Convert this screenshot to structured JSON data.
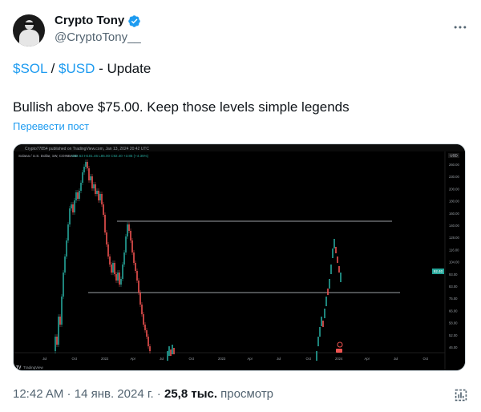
{
  "author": {
    "display_name": "Crypto Tony",
    "handle": "@CryptoTony__",
    "verified_color": "#1d9bf0"
  },
  "tweet": {
    "pair_base": "$SOL",
    "separator": " / ",
    "pair_quote": "$USD",
    "title_suffix": " - Update",
    "body": "Bullish above $75.00. Keep those levels simple legends",
    "translate_link": "Перевести пост"
  },
  "chart": {
    "header_text": "Crypto77854 published on TradingView.com, Jan 13, 2024 20:42 UTC",
    "symbol_line": "Solana / U.S. Dollar, 1W, COINBASE",
    "ohlc": "O92.63 H101.46 L85.00 C92.40 +3.85 (+4.35%)",
    "currency_label": "USD",
    "price_ticks": [
      "260.00",
      "230.00",
      "200.00",
      "180.00",
      "160.00",
      "140.00",
      "128.00",
      "116.00",
      "104.00",
      "93.00",
      "83.00",
      "75.00",
      "66.00",
      "58.00",
      "52.00",
      "46.00"
    ],
    "current_price": "92.40",
    "time_ticks": [
      "Jul",
      "Oct",
      "2022",
      "Apr",
      "Jul",
      "Oct",
      "2023",
      "Apr",
      "Jul",
      "Oct",
      "2024",
      "Apr",
      "Jul",
      "Oct"
    ],
    "watermark": "TradingView",
    "colors": {
      "up": "#26a69a",
      "down": "#ef5350",
      "level": "#d1d4dc"
    }
  },
  "meta": {
    "time": "12:42 AM",
    "dot": " · ",
    "date": "14 янв. 2024 г.",
    "views_count": "25,8 тыс.",
    "views_label": " просмотр"
  }
}
